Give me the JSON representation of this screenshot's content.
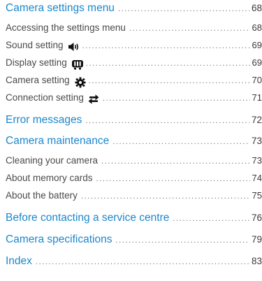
{
  "toc": {
    "entries": [
      {
        "title": "Camera settings menu",
        "page": "68"
      },
      {
        "title": "Accessing the settings menu",
        "page": "68"
      },
      {
        "title": "Sound setting",
        "icon": "speaker-icon",
        "page": "69"
      },
      {
        "title": "Display setting",
        "icon": "display-icon",
        "page": "69"
      },
      {
        "title": "Camera setting",
        "icon": "gear-icon",
        "page": "70"
      },
      {
        "title": "Connection setting",
        "icon": "connection-icon",
        "page": "71"
      },
      {
        "title": "Error messages",
        "page": "72"
      },
      {
        "title": "Camera maintenance",
        "page": "73"
      },
      {
        "title": "Cleaning your camera",
        "page": "73"
      },
      {
        "title": "About memory cards",
        "page": "74"
      },
      {
        "title": "About the battery",
        "page": "75"
      },
      {
        "title": "Before contacting a service centre",
        "page": "76"
      },
      {
        "title": "Camera specifications",
        "page": "79"
      },
      {
        "title": "Index",
        "page": "83"
      }
    ]
  },
  "colors": {
    "section_title": "#1c87cc",
    "sub_title": "#4a4a4a",
    "leader_dots": "#6a6a6a",
    "icon": "#111111"
  }
}
